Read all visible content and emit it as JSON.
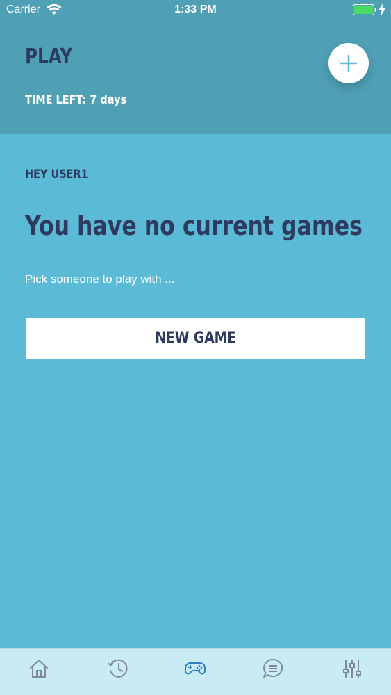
{
  "status_bar": {
    "carrier": "Carrier",
    "time": "1:33 PM",
    "battery_color": "#4cd964"
  },
  "header": {
    "title": "PLAY",
    "time_left": "TIME LEFT: 7 days",
    "add_icon": "plus-icon"
  },
  "main": {
    "greeting": "HEY USER1",
    "headline": "You have no current games",
    "subtext": "Pick someone to play with ...",
    "new_game_label": "NEW GAME"
  },
  "tab_bar": {
    "items": [
      {
        "icon": "home-icon",
        "active": false
      },
      {
        "icon": "history-icon",
        "active": false
      },
      {
        "icon": "gamepad-icon",
        "active": true
      },
      {
        "icon": "chat-icon",
        "active": false
      },
      {
        "icon": "settings-sliders-icon",
        "active": false
      }
    ],
    "active_color": "#2d7fc4",
    "inactive_color": "#7f8a94"
  },
  "colors": {
    "header_bg": "#4f9fb5",
    "body_bg": "#5bbad5",
    "text_dark": "#2e3a5f",
    "accent": "#5bbad5"
  }
}
